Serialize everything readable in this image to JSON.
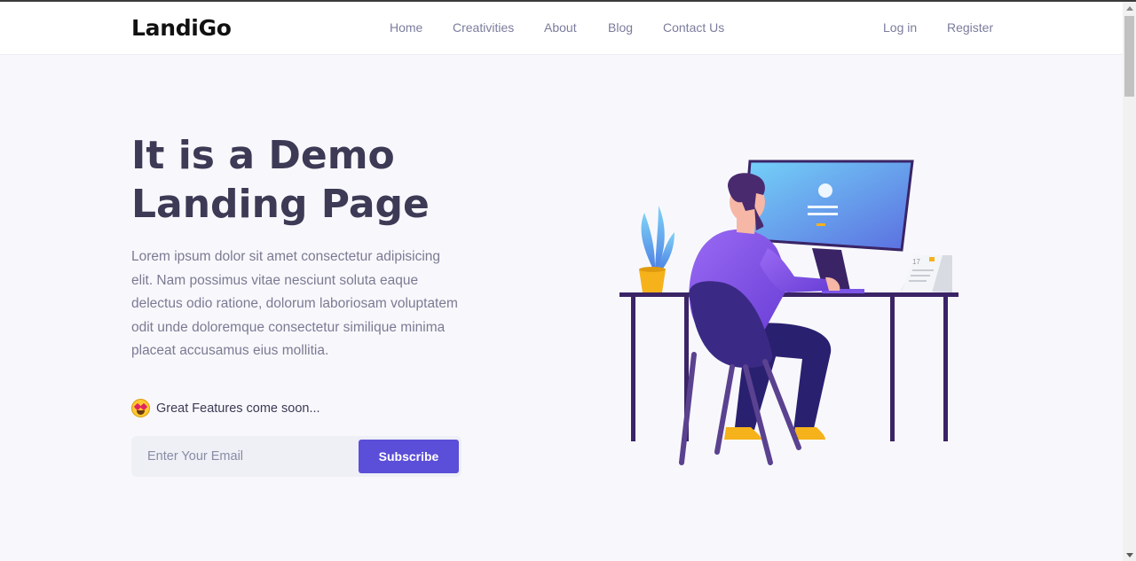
{
  "brand": {
    "logo": "LandiGo",
    "accent": "#5b4ed8"
  },
  "nav": {
    "items": [
      {
        "label": "Home"
      },
      {
        "label": "Creativities"
      },
      {
        "label": "About"
      },
      {
        "label": "Blog"
      },
      {
        "label": "Contact Us"
      }
    ],
    "login": "Log in",
    "register": "Register"
  },
  "hero": {
    "title_line1": "It is a Demo",
    "title_line2": "Landing Page",
    "description": "Lorem ipsum dolor sit amet consectetur adipisicing elit. Nam possimus vitae nesciunt soluta eaque delectus odio ratione, dolorum laboriosam voluptatem odit unde doloremque consectetur similique minima placeat accusamus eius mollitia.",
    "feature_icon": "star-struck-emoji-icon",
    "feature_text": "Great Features come soon...",
    "email_placeholder": "Enter Your Email",
    "subscribe_label": "Subscribe"
  },
  "illustration": {
    "name": "person-at-desk-illustration",
    "calendar_day": "17"
  }
}
